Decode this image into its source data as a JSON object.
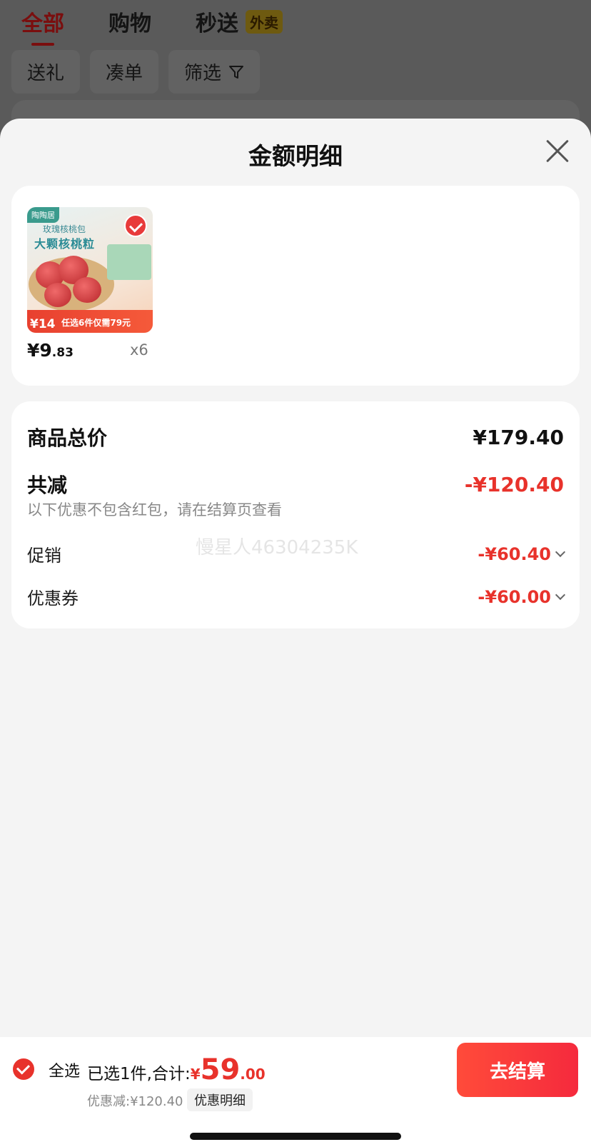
{
  "background": {
    "tabs": [
      "全部",
      "购物",
      "秒送"
    ],
    "tab_badge": "外卖",
    "chips": [
      "送礼",
      "凑单",
      "筛选"
    ]
  },
  "sheet": {
    "title": "金额明细",
    "product": {
      "thumb_brand": "陶陶居",
      "thumb_subtitle": "玫瑰核桃包",
      "thumb_headline": "大颗核桃粒",
      "thumb_price": "¥14",
      "thumb_promo": "任选6件仅需79元",
      "price_int": "¥9",
      "price_dec": ".83",
      "quantity": "x6"
    },
    "summary": {
      "total_label": "商品总价",
      "total_value": "¥179.40",
      "reduce_label": "共减",
      "reduce_value": "-¥120.40",
      "note": "以下优惠不包含红包，请在结算页查看",
      "promo_label": "促销",
      "promo_value": "-¥60.40",
      "coupon_label": "优惠券",
      "coupon_value": "-¥60.00",
      "watermark": "慢星人46304235K"
    }
  },
  "bottom_bar": {
    "select_all": "全选",
    "selected_prefix": "已选1件,合计:",
    "total_symbol": "¥",
    "total_int": "59",
    "total_dec": ".00",
    "discount": "优惠减:¥120.40",
    "detail_link": "优惠明细",
    "checkout": "去结算"
  },
  "colors": {
    "accent": "#e8322b",
    "background": "#f4f4f4"
  }
}
